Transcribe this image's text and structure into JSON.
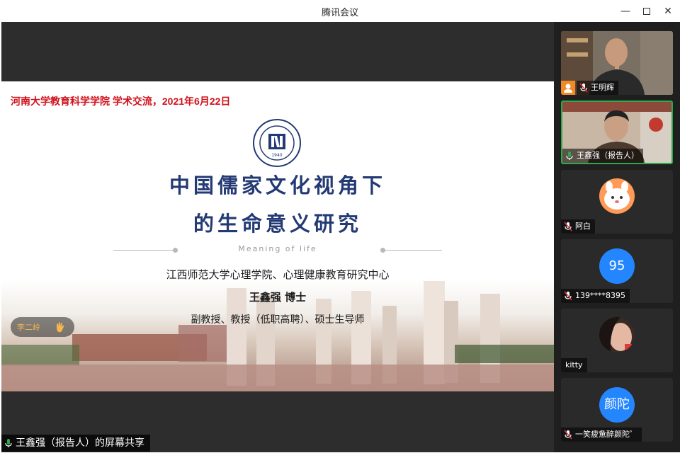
{
  "window": {
    "title": "腾讯会议"
  },
  "slide": {
    "header": "河南大学教育科学学院 学术交流，2021年6月22日",
    "logo_year": "1940",
    "title_line1": "中国儒家文化视角下",
    "title_line2": "的生命意义研究",
    "subtitle_en": "Meaning of life",
    "institution": "江西师范大学心理学院、心理健康教育研究中心",
    "author": "王鑫强 博士",
    "roles": "副教授、教授（低职高聘）、硕士生导师"
  },
  "speaker_indicator": {
    "name": "李二岭",
    "icon": "hand-wave-icon"
  },
  "share_label": "王鑫强（报告人）的屏幕共享",
  "participants": [
    {
      "name": "王明辉",
      "type": "video",
      "host": true,
      "mic": "muted"
    },
    {
      "name": "王鑫强（报告人）",
      "type": "video",
      "active_speaker": true,
      "mic": "on"
    },
    {
      "name": "阿白",
      "type": "avatar-image",
      "mic": "muted"
    },
    {
      "name": "139****8395",
      "type": "avatar-text",
      "avatar_text": "95",
      "mic": "muted"
    },
    {
      "name": "kitty",
      "type": "avatar-image",
      "mic": "none"
    },
    {
      "name": "一笑疲惫醉颜陀゜",
      "type": "avatar-text",
      "avatar_text": "颜陀",
      "mic": "muted"
    }
  ],
  "colors": {
    "slide_header": "#d0101a",
    "slide_title": "#243a74",
    "active_border": "#2fa84a",
    "avatar_blue": "#2486ff",
    "host_badge": "#f08a24"
  }
}
